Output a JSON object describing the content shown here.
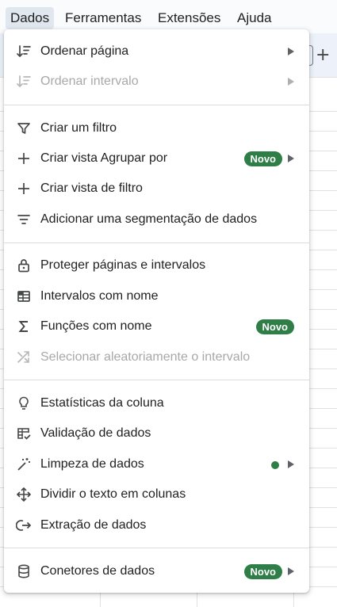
{
  "menubar": {
    "items": [
      {
        "label": "Dados",
        "active": true
      },
      {
        "label": "Ferramentas"
      },
      {
        "label": "Extensões"
      },
      {
        "label": "Ajuda"
      }
    ]
  },
  "toolbar": {
    "add_sheet_glyph": "+"
  },
  "menu": {
    "items": [
      {
        "label": "Ordenar página",
        "icon": "sort-icon",
        "submenu": true
      },
      {
        "label": "Ordenar intervalo",
        "icon": "sort-range-icon",
        "submenu": true,
        "disabled": true
      },
      {
        "label": "Criar um filtro",
        "icon": "filter-icon"
      },
      {
        "label": "Criar vista Agrupar por",
        "icon": "plus-icon",
        "badge": "Novo",
        "submenu": true
      },
      {
        "label": "Criar vista de filtro",
        "icon": "plus-icon"
      },
      {
        "label": "Adicionar uma segmentação de dados",
        "icon": "slicer-icon"
      },
      {
        "label": "Proteger páginas e intervalos",
        "icon": "lock-icon"
      },
      {
        "label": "Intervalos com nome",
        "icon": "named-range-icon"
      },
      {
        "label": "Funções com nome",
        "icon": "sigma-icon",
        "badge": "Novo"
      },
      {
        "label": "Selecionar aleatoriamente o intervalo",
        "icon": "shuffle-icon",
        "disabled": true
      },
      {
        "label": "Estatísticas da coluna",
        "icon": "lightbulb-icon"
      },
      {
        "label": "Validação de dados",
        "icon": "data-validation-icon"
      },
      {
        "label": "Limpeza de dados",
        "icon": "magic-wand-icon",
        "dot": true,
        "submenu": true
      },
      {
        "label": "Dividir o texto em colunas",
        "icon": "split-columns-icon"
      },
      {
        "label": "Extração de dados",
        "icon": "extraction-icon"
      },
      {
        "label": "Conetores de dados",
        "icon": "database-icon",
        "badge": "Novo",
        "submenu": true
      }
    ]
  },
  "colors": {
    "badge_bg": "#2f7d47",
    "menubar_active": "#e1e7ef",
    "disabled_text": "#a8a8a8"
  }
}
